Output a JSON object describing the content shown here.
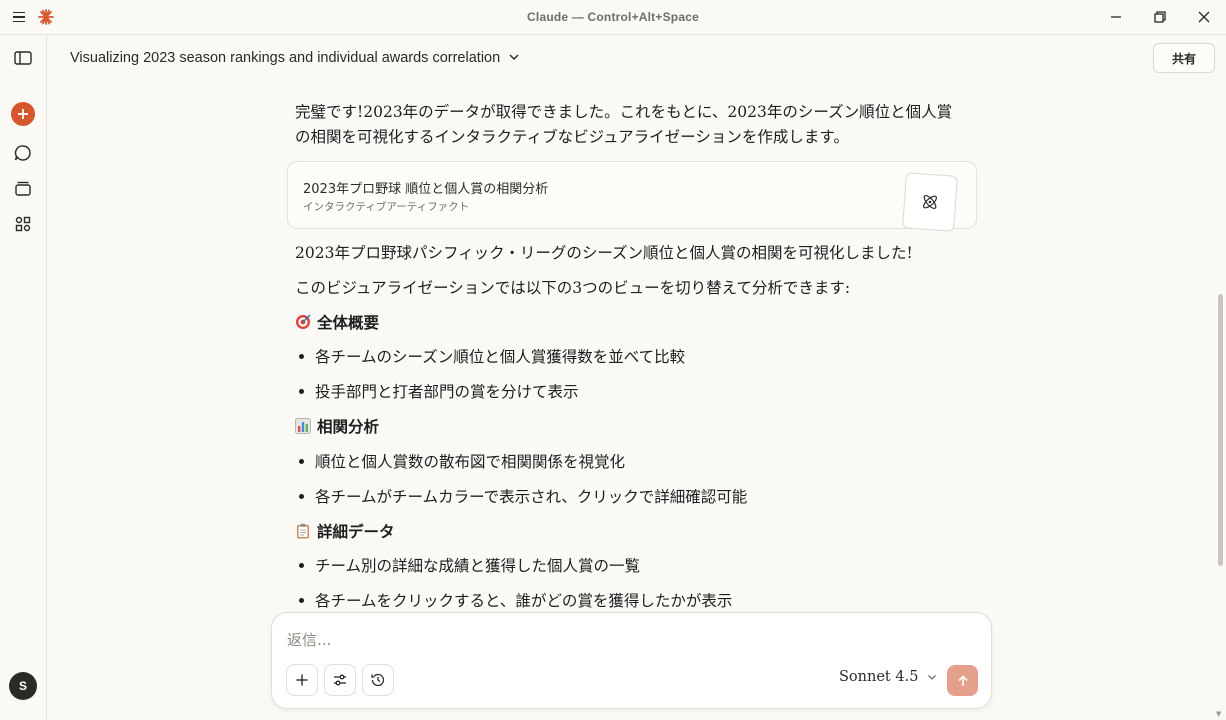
{
  "window": {
    "title": "Claude — Control+Alt+Space"
  },
  "header": {
    "conversation_title": "Visualizing 2023 season rankings and individual awards correlation",
    "share_label": "共有"
  },
  "user": {
    "avatar_initial": "S"
  },
  "message": {
    "intro": "完璧です!2023年のデータが取得できました。これをもとに、2023年のシーズン順位と個人賞の相関を可視化するインタラクティブなビジュアライゼーションを作成します。",
    "artifact": {
      "title": "2023年プロ野球 順位と個人賞の相関分析",
      "subtitle": "インタラクティブアーティファクト"
    },
    "summary": "2023年プロ野球パシフィック・リーグのシーズン順位と個人賞の相関を可視化しました!",
    "views_intro": "このビジュアライゼーションでは以下の3つのビューを切り替えて分析できます:",
    "sections": [
      {
        "heading": "全体概要",
        "icon": "target-icon",
        "bullets": [
          "各チームのシーズン順位と個人賞獲得数を並べて比較",
          "投手部門と打者部門の賞を分けて表示"
        ]
      },
      {
        "heading": "相関分析",
        "icon": "bar-chart-icon",
        "bullets": [
          "順位と個人賞数の散布図で相関関係を視覚化",
          "各チームがチームカラーで表示され、クリックで詳細確認可能"
        ]
      },
      {
        "heading": "詳細データ",
        "icon": "clipboard-icon",
        "bullets": [
          "チーム別の詳細な成績と獲得した個人賞の一覧",
          "各チームをクリックすると、誰がどの賞を獲得したかが表示"
        ]
      }
    ]
  },
  "composer": {
    "placeholder": "返信...",
    "model_label": "Sonnet 4.5"
  },
  "colors": {
    "accent": "#d4572e",
    "send_button": "#e4a08a",
    "background": "#faf9f5"
  }
}
